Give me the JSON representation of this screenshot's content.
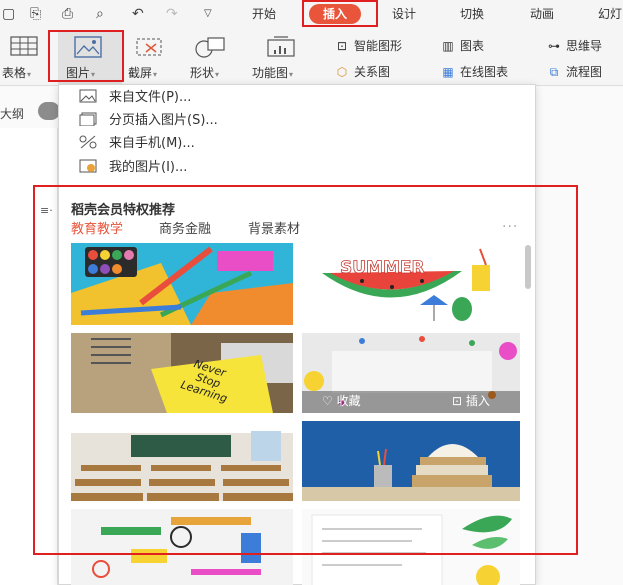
{
  "menu": {
    "tabs": [
      "开始",
      "设计",
      "切换",
      "动画",
      "幻灯"
    ],
    "active_tab": "插入"
  },
  "ribbon": {
    "table_label": "表格",
    "picture_label": "图片",
    "screenshot_label": "截屏",
    "shape_label": "形状",
    "function_label": "功能图",
    "smart_shape_label": "智能图形",
    "chart_label": "图表",
    "mindmap_label": "思维导",
    "relation_label": "关系图",
    "online_chart_label": "在线图表",
    "flowchart_label": "流程图"
  },
  "sidebar": {
    "outline_label": "大纲"
  },
  "dropdown": {
    "items": [
      {
        "label": "来自文件(P)..."
      },
      {
        "label": "分页插入图片(S)..."
      },
      {
        "label": "来自手机(M)..."
      },
      {
        "label": "我的图片(I)..."
      }
    ],
    "section_title": "稻壳会员特权推荐",
    "categories": [
      "教育教学",
      "商务金融",
      "背景素材"
    ],
    "active_category": "教育教学",
    "more": "···",
    "thumbnail_actions": {
      "collect": "收藏",
      "insert": "插入"
    },
    "summer_text": "SUMMER"
  },
  "colors": {
    "accent": "#e8553b",
    "highlight_box": "#e02020",
    "active_category": "#e8553b"
  }
}
